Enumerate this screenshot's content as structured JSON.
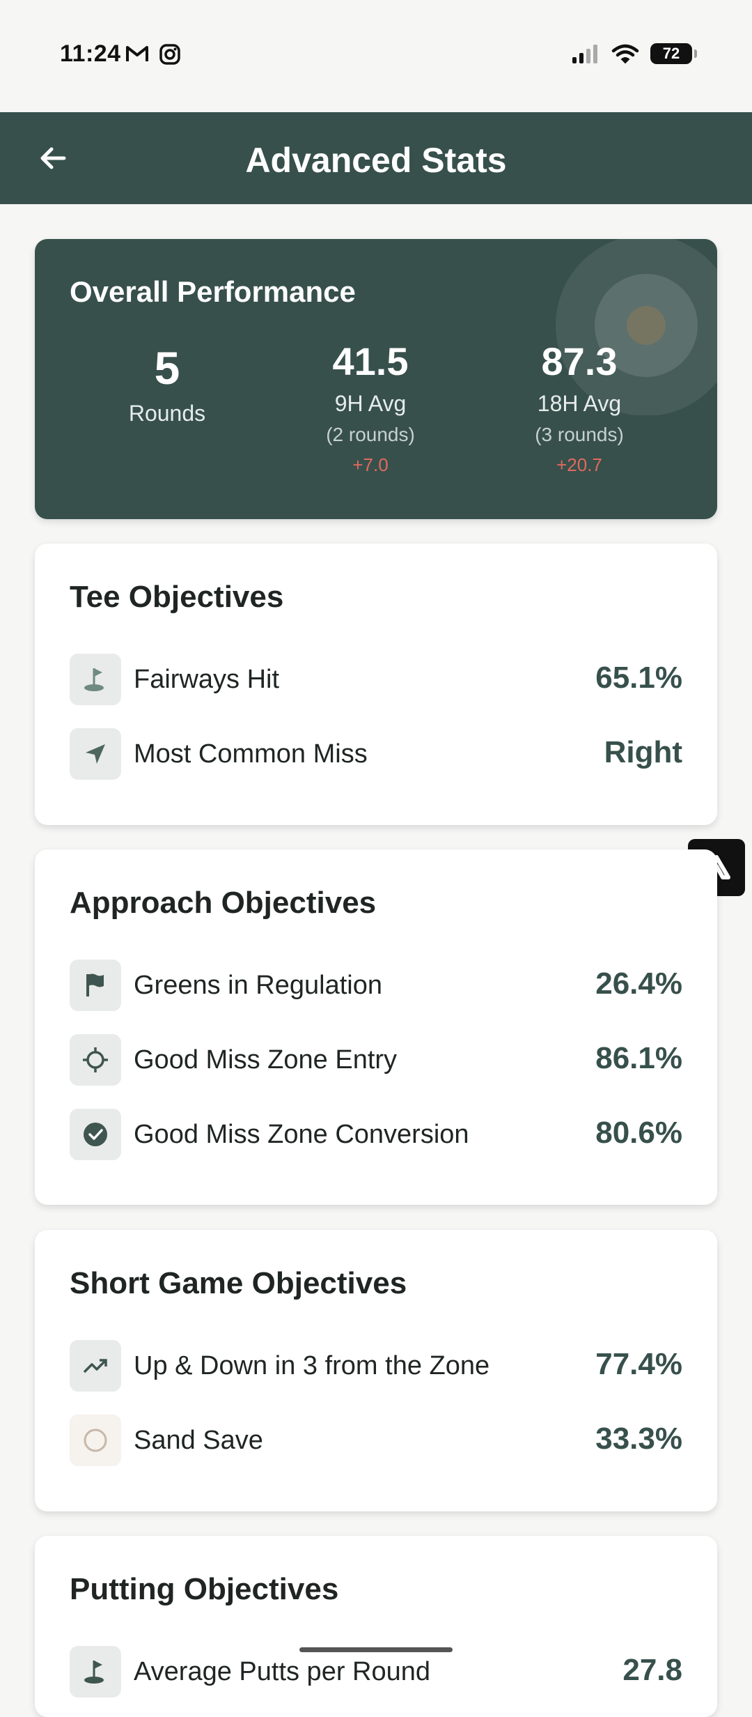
{
  "status": {
    "time": "11:24",
    "battery": "72"
  },
  "header": {
    "title": "Advanced Stats"
  },
  "overall": {
    "title": "Overall Performance",
    "rounds": {
      "value": "5",
      "label": "Rounds"
    },
    "nine_hole": {
      "value": "41.5",
      "label": "9H Avg",
      "sub": "(2 rounds)",
      "delta": "+7.0"
    },
    "eighteen_hole": {
      "value": "87.3",
      "label": "18H Avg",
      "sub": "(3 rounds)",
      "delta": "+20.7"
    }
  },
  "tee": {
    "title": "Tee Objectives",
    "items": [
      {
        "label": "Fairways Hit",
        "value": "65.1%",
        "icon": "golf-flag-icon"
      },
      {
        "label": "Most Common Miss",
        "value": "Right",
        "icon": "navigation-arrow-icon"
      }
    ]
  },
  "approach": {
    "title": "Approach Objectives",
    "items": [
      {
        "label": "Greens in Regulation",
        "value": "26.4%",
        "icon": "flag-icon"
      },
      {
        "label": "Good Miss Zone Entry",
        "value": "86.1%",
        "icon": "crosshair-icon"
      },
      {
        "label": "Good Miss Zone Conversion",
        "value": "80.6%",
        "icon": "check-circle-icon"
      }
    ]
  },
  "short_game": {
    "title": "Short Game Objectives",
    "items": [
      {
        "label": "Up & Down in 3 from the Zone",
        "value": "77.4%",
        "icon": "trending-up-icon"
      },
      {
        "label": "Sand Save",
        "value": "33.3%",
        "icon": "circle-outline-icon"
      }
    ]
  },
  "putting": {
    "title": "Putting Objectives",
    "items": [
      {
        "label": "Average Putts per Round",
        "value": "27.8",
        "icon": "golf-flag-icon"
      }
    ]
  },
  "colors": {
    "primary": "#37504b",
    "negative": "#e06a5e",
    "background": "#f6f6f5"
  }
}
